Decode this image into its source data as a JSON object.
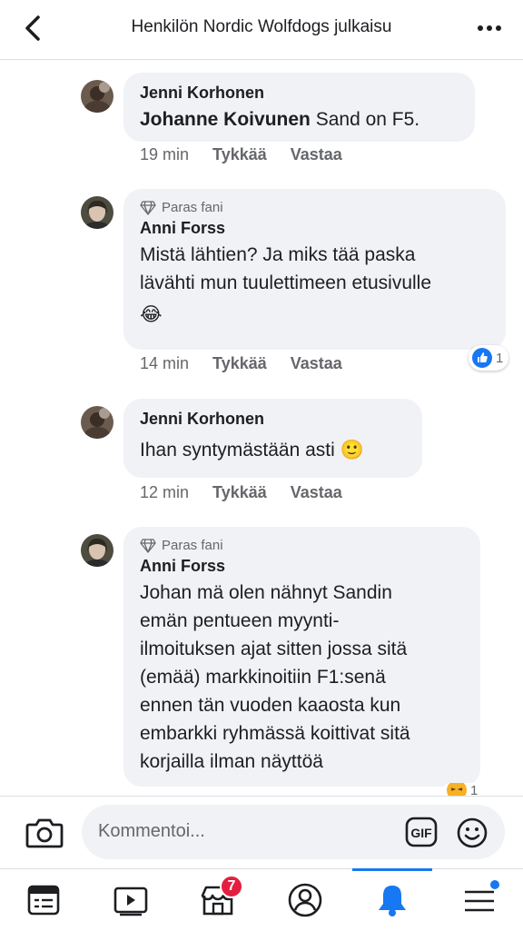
{
  "header": {
    "title": "Henkilön Nordic Wolfdogs julkaisu"
  },
  "comments": [
    {
      "name": "Jenni Korhonen",
      "mention": "Johanne Koivunen",
      "text": "Sand on F5.",
      "time": "19 min",
      "like": "Tykkää",
      "reply": "Vastaa"
    },
    {
      "badge": "Paras fani",
      "name": "Anni Forss",
      "text1": "Mistä lähtien? Ja miks tää paska",
      "text2": "lävähti mun tuulettimeen etusivulle",
      "emoji": "😂",
      "time": "14 min",
      "like": "Tykkää",
      "reply": "Vastaa",
      "reaction_count": "1"
    },
    {
      "name": "Jenni Korhonen",
      "text": "Ihan syntymästään asti",
      "emoji": "🙂",
      "time": "12 min",
      "like": "Tykkää",
      "reply": "Vastaa"
    },
    {
      "badge": "Paras fani",
      "name": "Anni Forss",
      "lines": [
        "Johan mä olen nähnyt Sandin",
        "emän pentueen myynti-",
        "ilmoituksen ajat sitten jossa sitä",
        "(emää) markkinoitiin F1:senä",
        "ennen tän vuoden kaaosta kun",
        "embarkki ryhmässä koittivat sitä",
        "korjailla ilman näyttöä"
      ],
      "reaction_count": "1"
    }
  ],
  "composer": {
    "placeholder": "Kommentoi...",
    "gif_label": "GIF"
  },
  "nav": {
    "badge_count": "7"
  },
  "colors": {
    "accent": "#1877f2",
    "badge": "#e41e3f",
    "bubble": "#f0f2f5"
  }
}
